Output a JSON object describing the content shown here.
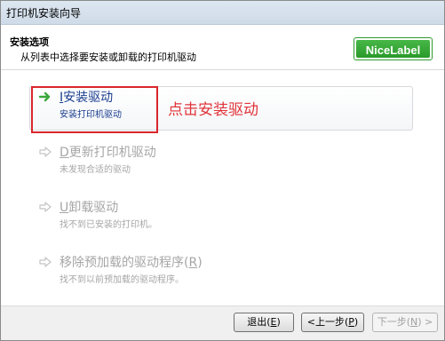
{
  "window": {
    "title": "打印机安装向导"
  },
  "header": {
    "title": "安装选项",
    "subtitle": "从列表中选择要安装或卸载的打印机驱动",
    "logo_text": "NiceLabel"
  },
  "options": [
    {
      "key": "I",
      "label": "安装驱动",
      "desc": "安装打印机驱动",
      "state": "active"
    },
    {
      "key": "D",
      "label": "更新打印机驱动",
      "desc": "未发现合适的驱动",
      "state": "disabled"
    },
    {
      "key": "U",
      "label": "卸载驱动",
      "desc": "找不到已安装的打印机。",
      "state": "disabled"
    },
    {
      "label_prefix": "移除预加载的驱动程序(",
      "key": "R",
      "label_suffix": ")",
      "desc": "找不到以前预加载的驱动程序。",
      "state": "disabled"
    }
  ],
  "annotation": {
    "text": "点击安装驱动",
    "color": "#e0343a"
  },
  "buttons": {
    "exit": {
      "prefix": "退出(",
      "key": "E",
      "suffix": ")"
    },
    "back": {
      "prefix": "<上一步(",
      "key": "P",
      "suffix": ")"
    },
    "next": {
      "prefix": "下一步(",
      "key": "N",
      "suffix": ") >"
    }
  },
  "colors": {
    "active_text": "#1a3d8f",
    "disabled_text": "#a6a6a6",
    "highlight_border": "#d9262c",
    "logo_green": "#2e9b2e",
    "arrow_green": "#3aa83a"
  },
  "icons": {
    "active_arrow": "arrow-right-icon",
    "disabled_arrow": "arrow-right-disabled-icon"
  }
}
